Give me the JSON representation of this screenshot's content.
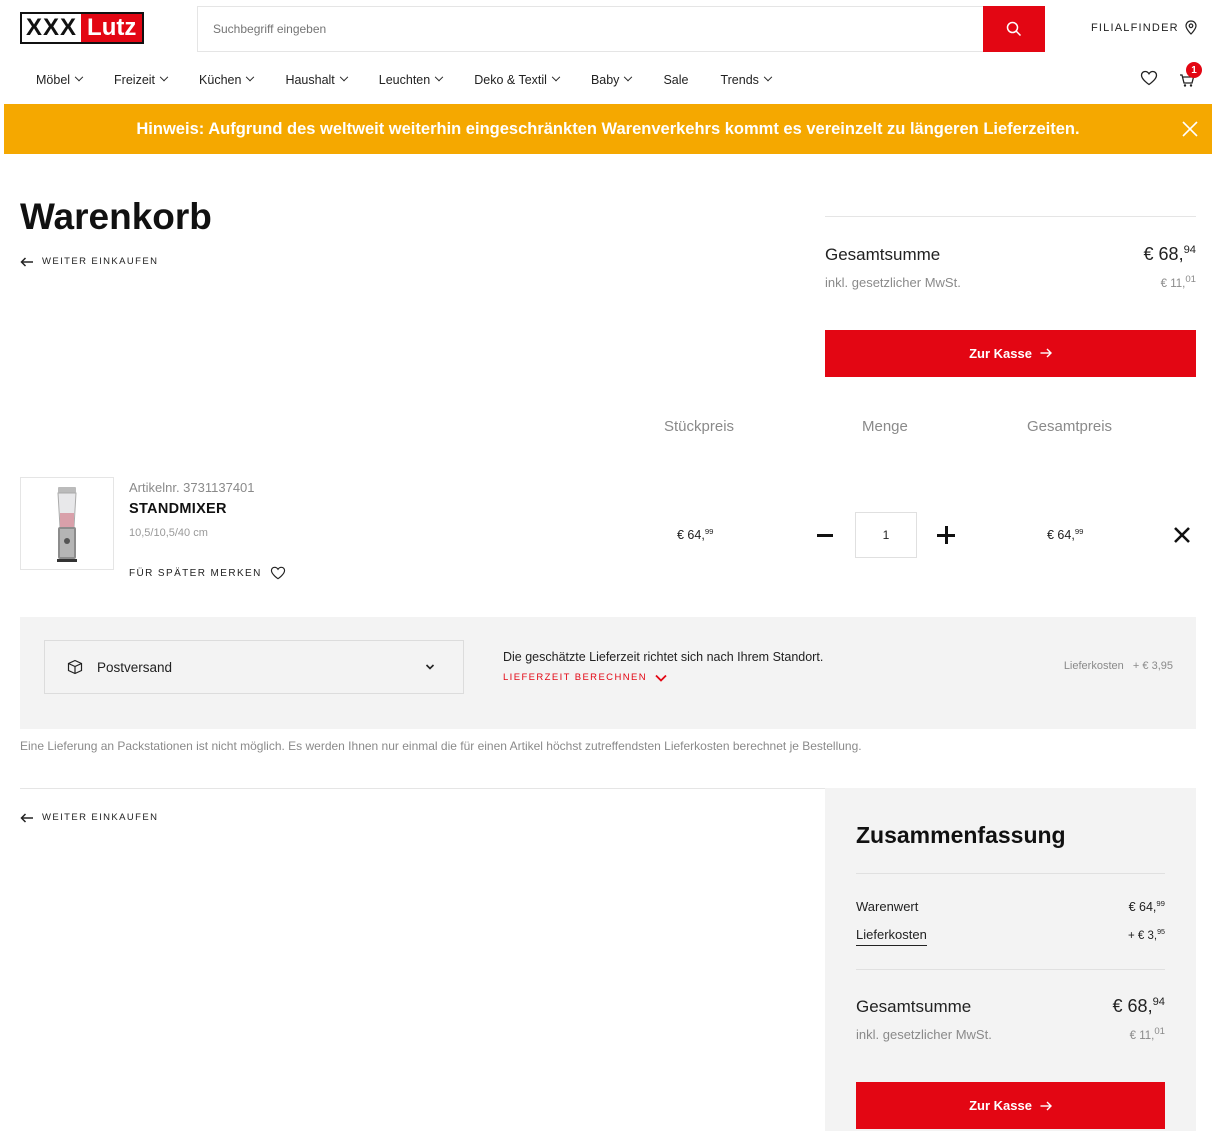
{
  "header": {
    "logo_xxx": "XXX",
    "logo_lutz": "Lutz",
    "search_placeholder": "Suchbegriff eingeben",
    "filialfinder": "FILIALFINDER",
    "cart_count": "1"
  },
  "nav": {
    "items": [
      "Möbel",
      "Freizeit",
      "Küchen",
      "Haushalt",
      "Leuchten",
      "Deko & Textil",
      "Baby",
      "Sale",
      "Trends"
    ]
  },
  "notice": {
    "text": "Hinweis: Aufgrund des weltweit weiterhin eingeschränkten Warenverkehrs kommt es vereinzelt zu längeren Lieferzeiten."
  },
  "page": {
    "title": "Warenkorb",
    "back_link": "WEITER EINKAUFEN"
  },
  "summary_top": {
    "total_label": "Gesamtsumme",
    "total_main": "€ 68,",
    "total_cents": "94",
    "vat_label": "inkl. gesetzlicher MwSt.",
    "vat_main": "€ 11,",
    "vat_cents": "01",
    "checkout_label": "Zur Kasse"
  },
  "table": {
    "col_unit_price": "Stückpreis",
    "col_quantity": "Menge",
    "col_total": "Gesamtpreis"
  },
  "item": {
    "article_no": "Artikelnr. 3731137401",
    "name": "STANDMIXER",
    "dimensions": "10,5/10,5/40 cm",
    "save_later": "FÜR SPÄTER MERKEN",
    "unit_price_main": "€ 64,",
    "unit_price_cents": "99",
    "quantity": "1",
    "total_main": "€ 64,",
    "total_cents": "99"
  },
  "shipping": {
    "method": "Postversand",
    "info": "Die geschätzte Lieferzeit richtet sich nach Ihrem Standort.",
    "calc_link": "LIEFERZEIT BERECHNEN",
    "cost_label": "Lieferkosten",
    "cost_value": "+ € 3,95",
    "note": "Eine Lieferung an Packstationen ist nicht möglich. Es werden Ihnen nur einmal die für einen Artikel höchst zutreffendsten Lieferkosten berechnet je Bestellung."
  },
  "summary": {
    "title": "Zusammenfassung",
    "goods_label": "Warenwert",
    "goods_main": "€ 64,",
    "goods_cents": "99",
    "delivery_label": "Lieferkosten",
    "delivery_main": "+ € 3,",
    "delivery_cents": "95",
    "total_label": "Gesamtsumme",
    "total_main": "€ 68,",
    "total_cents": "94",
    "vat_label": "inkl. gesetzlicher MwSt.",
    "vat_main": "€ 11,",
    "vat_cents": "01",
    "checkout_label": "Zur Kasse"
  },
  "icons": {
    "search": "search-icon",
    "location": "location-pin-icon",
    "wishlist": "heart-icon",
    "cart": "cart-icon",
    "close": "close-icon",
    "back": "arrow-left-icon",
    "forward": "arrow-right-icon",
    "package": "package-icon",
    "remove": "close-icon",
    "dropdown": "chevron-down-icon"
  },
  "colors": {
    "brand_red": "#e30613",
    "notice_orange": "#f5a800"
  }
}
